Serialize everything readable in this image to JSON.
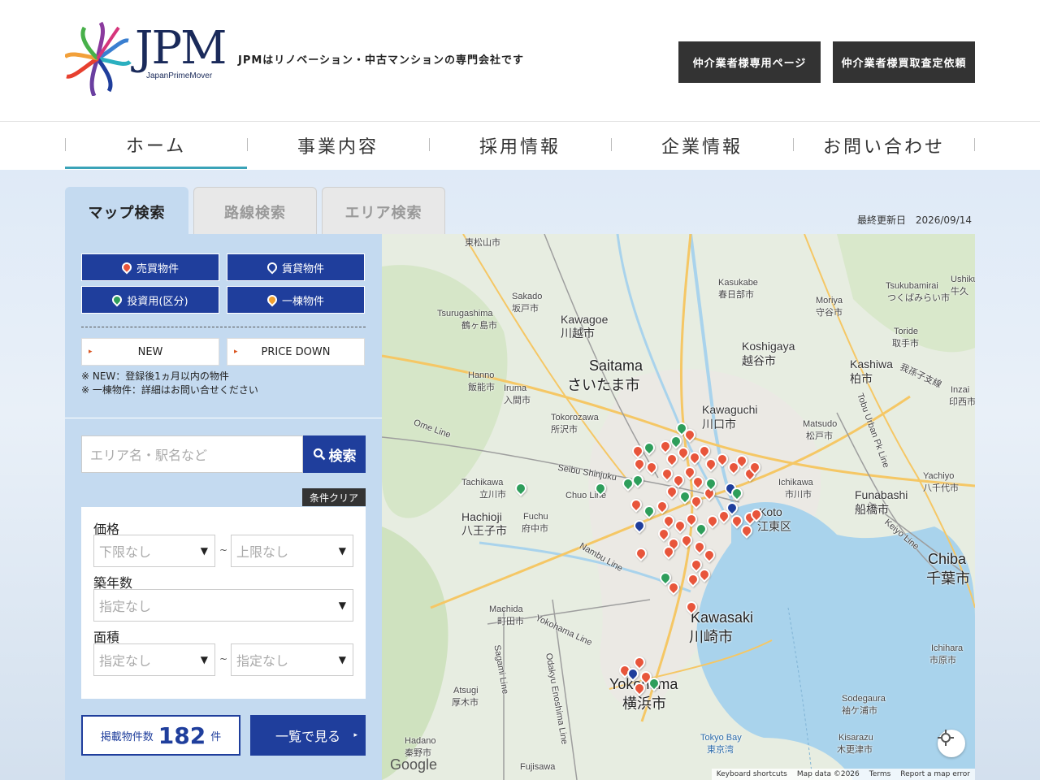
{
  "header": {
    "logo_text": "JPM",
    "logo_sub": "JapanPrimeMover",
    "tagline": "JPMはリノベーション・中古マンションの専門会社です",
    "buttons": [
      "仲介業者様専用ページ",
      "仲介業者様買取査定依頼"
    ]
  },
  "nav": {
    "items": [
      "ホーム",
      "事業内容",
      "採用情報",
      "企業情報",
      "お問い合わせ"
    ],
    "active_index": 0,
    "accent_color": "#3aa3b8"
  },
  "search_tabs": {
    "items": [
      "マップ検索",
      "路線検索",
      "エリア検索"
    ],
    "active_index": 0
  },
  "last_updated": {
    "label": "最終更新日",
    "date": "2026/09/14"
  },
  "categories": [
    {
      "label": "売買物件",
      "pin_color": "#e8553b"
    },
    {
      "label": "賃貸物件",
      "pin_color": "#1f3e9c"
    },
    {
      "label": "投資用(区分)",
      "pin_color": "#2e9e5b"
    },
    {
      "label": "一棟物件",
      "pin_color": "#f0a030"
    }
  ],
  "flags": [
    "NEW",
    "PRICE DOWN"
  ],
  "notes": [
    "※ NEW：登録後1ヵ月以内の物件",
    "※ 一棟物件：詳細はお問い合せください"
  ],
  "search": {
    "placeholder": "エリア名・駅名など",
    "button": "検索",
    "clear": "条件クリア"
  },
  "filters": {
    "price": {
      "label": "価格",
      "min": "下限なし",
      "max": "上限なし",
      "sep": "~"
    },
    "age": {
      "label": "築年数",
      "value": "指定なし"
    },
    "area": {
      "label": "面積",
      "min": "指定なし",
      "max": "指定なし",
      "sep": "~"
    }
  },
  "results": {
    "label": "掲載物件数",
    "count": "182",
    "unit": "件",
    "list_button": "一覧で見る"
  },
  "map": {
    "labels_big": [
      "Saitama",
      "さいたま市",
      "Kawasaki",
      "川崎市",
      "Chiba",
      "千葉市",
      "Yokohama",
      "横浜市",
      "Koto",
      "江東区"
    ],
    "labels_med": [
      "Kawagoe",
      "川越市",
      "Koshigaya",
      "越谷市",
      "Kashiwa",
      "柏市",
      "Kawaguchi",
      "川口市",
      "Hachioji",
      "八王子市",
      "Funabashi",
      "船橋市"
    ],
    "labels_small": [
      "東松山市",
      "Sakado",
      "坂戸市",
      "Tsurugashima",
      "鶴ヶ島市",
      "Kasukabe",
      "春日部市",
      "Tsukubamirai",
      "つくばみらい市",
      "Moriya",
      "守谷市",
      "Toride",
      "取手市",
      "Hanno",
      "飯能市",
      "Iruma",
      "入間市",
      "Tokorozawa",
      "所沢市",
      "Tachikawa",
      "立川市",
      "Fuchu",
      "府中市",
      "Machida",
      "町田市",
      "Atsugi",
      "厚木市",
      "Hadano",
      "秦野市",
      "Matsudo",
      "松戸市",
      "Ichikawa",
      "市川市",
      "Yachiyo",
      "八千代市",
      "Ichihara",
      "市原市",
      "Sodegaura",
      "袖ケ浦市",
      "Kisarazu",
      "木更津市",
      "Tokyo Bay",
      "東京湾",
      "Fujisawa",
      "Chuo Line",
      "Ome Line",
      "Seibu Shinjuku",
      "Nambu Line",
      "Yokohama Line",
      "Keiyo Line",
      "Tobu Urban Pk Line",
      "Sagami Line",
      "Odakyu Enoshima Line",
      "我孫子支線",
      "Inzai",
      "印西市",
      "Ushiku",
      "牛久"
    ],
    "google": "Google",
    "attribution": [
      "Keyboard shortcuts",
      "Map data ©2026",
      "Terms",
      "Report a map error"
    ]
  }
}
